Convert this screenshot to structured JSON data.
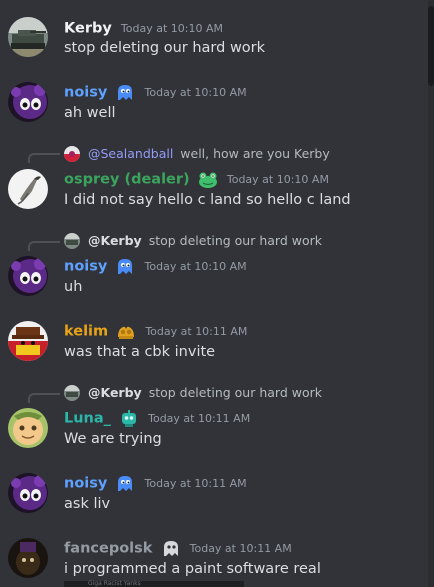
{
  "colors": {
    "background": "#313338",
    "text": "#dbdee1",
    "timestamp": "#949ba4",
    "mention": "#949cf7"
  },
  "messages": [
    {
      "username": "Kerby",
      "user_color": "#f2f3f5",
      "badge": "",
      "timestamp": "Today at 10:10 AM",
      "content": "stop deleting our hard work"
    },
    {
      "username": "noisy",
      "user_color": "#5ea1ff",
      "badge": "blue-ghost-badge-icon",
      "timestamp": "Today at 10:10 AM",
      "content": "ah well"
    },
    {
      "reply": {
        "user": "@Sealandball",
        "text": "well, how are you Kerby"
      },
      "username": "osprey (dealer)",
      "user_color": "#3ba55d",
      "badge": "green-frog-badge-icon",
      "timestamp": "Today at 10:10 AM",
      "content": "I did not say hello c land so hello c land"
    },
    {
      "reply": {
        "user": "@Kerby",
        "text": "stop deleting our hard work"
      },
      "username": "noisy",
      "user_color": "#5ea1ff",
      "badge": "blue-ghost-badge-icon",
      "timestamp": "Today at 10:10 AM",
      "content": "uh"
    },
    {
      "username": "kelim",
      "user_color": "#e8a317",
      "badge": "gold-hands-badge-icon",
      "timestamp": "Today at 10:11 AM",
      "content": "was that a cbk invite"
    },
    {
      "reply": {
        "user": "@Kerby",
        "text": "stop deleting our hard work"
      },
      "username": "Luna_",
      "user_color": "#2bb8a8",
      "badge": "teal-robot-badge-icon",
      "timestamp": "Today at 10:11 AM",
      "content": "We are trying"
    },
    {
      "username": "noisy",
      "user_color": "#5ea1ff",
      "badge": "blue-ghost-badge-icon",
      "timestamp": "Today at 10:11 AM",
      "content": "ask liv"
    },
    {
      "username": "fancepolsk",
      "user_color": "#949ba4",
      "badge": "white-ghost-badge-icon",
      "timestamp": "Today at 10:11 AM",
      "content": "i programmed a paint software real"
    }
  ],
  "peek_text": "Giga Racist Yanks"
}
